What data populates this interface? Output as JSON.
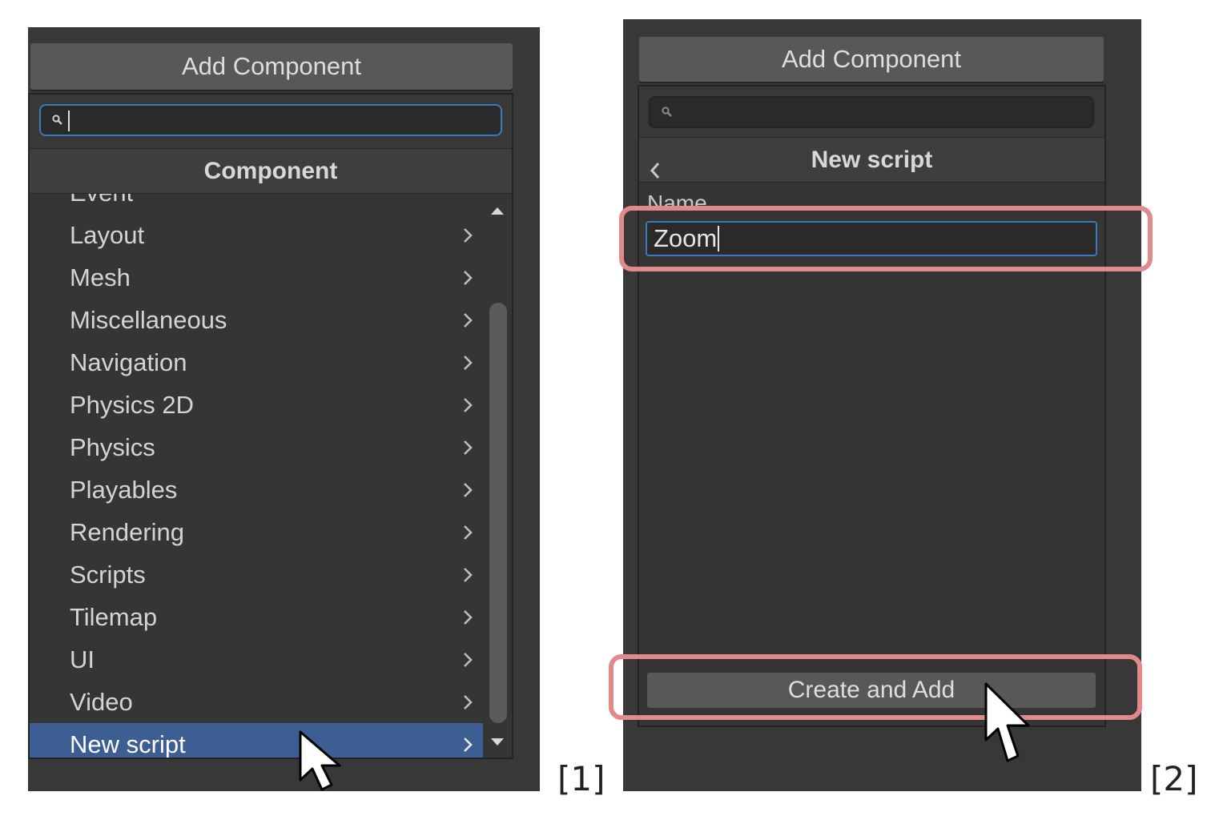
{
  "panel1": {
    "add_component_label": "Add Component",
    "search": {
      "value": "",
      "icon": "search-icon"
    },
    "header": "Component",
    "partial_item": "Event",
    "items": [
      {
        "label": "Layout"
      },
      {
        "label": "Mesh"
      },
      {
        "label": "Miscellaneous"
      },
      {
        "label": "Navigation"
      },
      {
        "label": "Physics 2D"
      },
      {
        "label": "Physics"
      },
      {
        "label": "Playables"
      },
      {
        "label": "Rendering"
      },
      {
        "label": "Scripts"
      },
      {
        "label": "Tilemap"
      },
      {
        "label": "UI"
      },
      {
        "label": "Video"
      },
      {
        "label": "New script",
        "selected": true
      }
    ],
    "step_label": "[1]"
  },
  "panel2": {
    "add_component_label": "Add Component",
    "search": {
      "value": "",
      "icon": "search-icon"
    },
    "header": "New script",
    "back_icon": "chevron-left-icon",
    "name_label": "Name",
    "name_value": "Zoom",
    "create_button": "Create and Add",
    "step_label": "[2]"
  },
  "colors": {
    "panel_bg": "#383838",
    "selected_bg": "#3d5e93",
    "focus_border": "#3a79bb",
    "highlight": "#e2898b"
  }
}
